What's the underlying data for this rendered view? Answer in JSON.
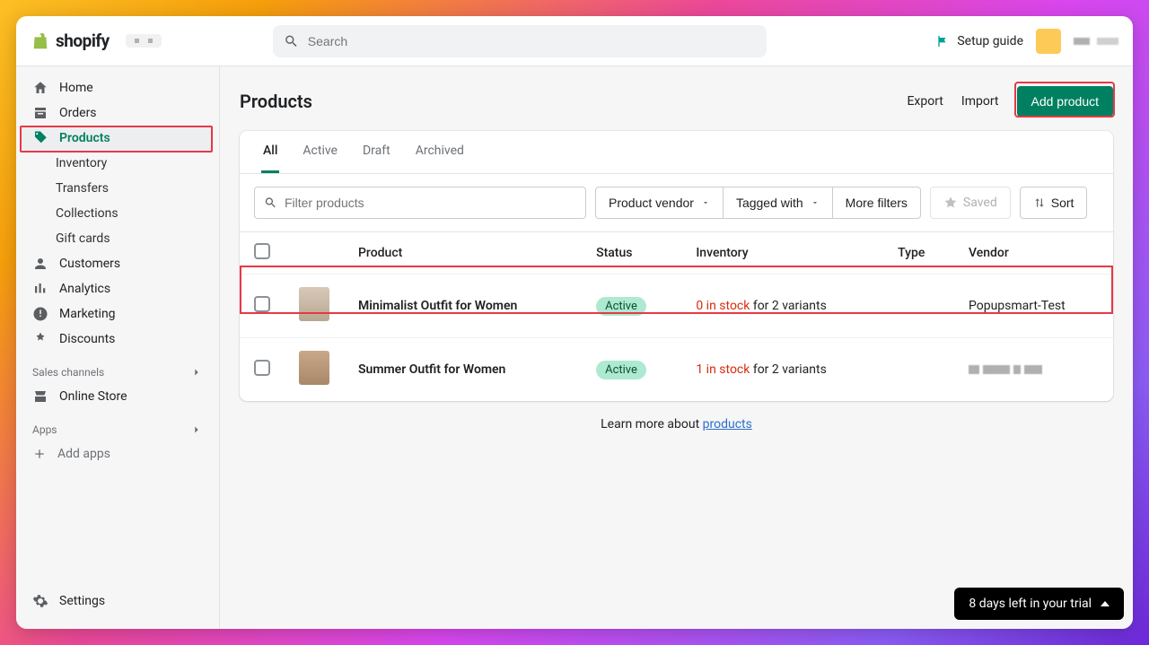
{
  "header": {
    "brand": "shopify",
    "search_placeholder": "Search",
    "setup_guide": "Setup guide"
  },
  "sidebar": {
    "items": [
      {
        "label": "Home"
      },
      {
        "label": "Orders"
      },
      {
        "label": "Products"
      },
      {
        "label": "Inventory"
      },
      {
        "label": "Transfers"
      },
      {
        "label": "Collections"
      },
      {
        "label": "Gift cards"
      },
      {
        "label": "Customers"
      },
      {
        "label": "Analytics"
      },
      {
        "label": "Marketing"
      },
      {
        "label": "Discounts"
      }
    ],
    "sections": {
      "sales_channels": "Sales channels",
      "online_store": "Online Store",
      "apps": "Apps",
      "add_apps": "Add apps",
      "settings": "Settings"
    }
  },
  "page": {
    "title": "Products",
    "actions": {
      "export": "Export",
      "import": "Import",
      "add": "Add product"
    }
  },
  "tabs": [
    "All",
    "Active",
    "Draft",
    "Archived"
  ],
  "filters": {
    "placeholder": "Filter products",
    "vendor": "Product vendor",
    "tagged": "Tagged with",
    "more": "More filters",
    "saved": "Saved",
    "sort": "Sort"
  },
  "table": {
    "columns": {
      "product": "Product",
      "status": "Status",
      "inventory": "Inventory",
      "type": "Type",
      "vendor": "Vendor"
    },
    "rows": [
      {
        "name": "Minimalist Outfit for Women",
        "status": "Active",
        "stock": "0 in stock",
        "variants": " for 2 variants",
        "vendor": "Popupsmart-Test"
      },
      {
        "name": "Summer Outfit for Women",
        "status": "Active",
        "stock": "1 in stock",
        "variants": " for 2 variants",
        "vendor": ""
      }
    ]
  },
  "learn": {
    "text": "Learn more about ",
    "link": "products"
  },
  "trial": "8 days left in your trial"
}
